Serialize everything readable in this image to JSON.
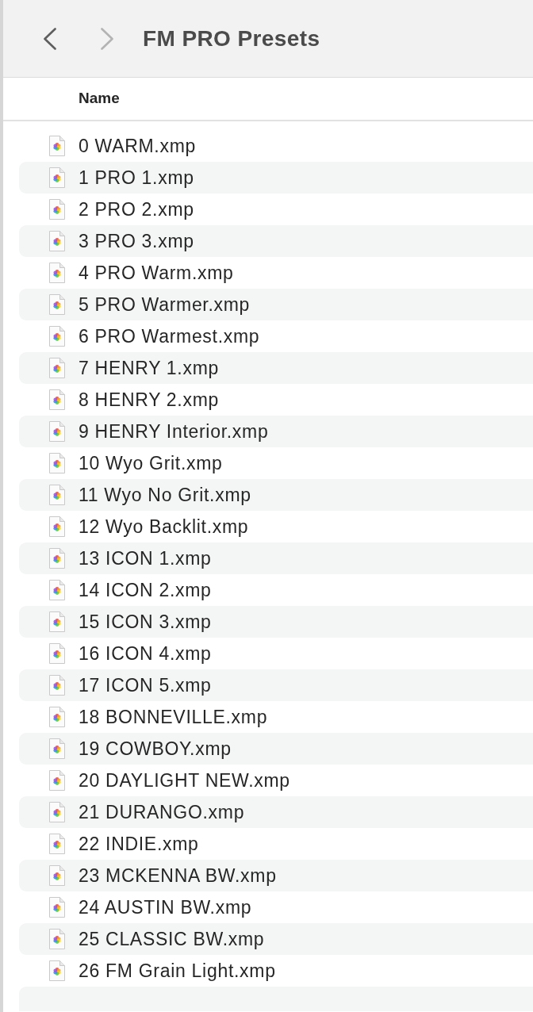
{
  "toolbar": {
    "back_button": {
      "disabled": false
    },
    "forward_button": {
      "disabled": true
    },
    "title": "FM PRO Presets"
  },
  "table": {
    "columns": [
      {
        "label": "Name"
      }
    ],
    "rows": [
      {
        "name": "0 WARM.xmp",
        "selected": false
      },
      {
        "name": "1 PRO 1.xmp",
        "selected": false
      },
      {
        "name": "2 PRO 2.xmp",
        "selected": false
      },
      {
        "name": "3 PRO 3.xmp",
        "selected": false
      },
      {
        "name": "4 PRO Warm.xmp",
        "selected": false
      },
      {
        "name": "5 PRO Warmer.xmp",
        "selected": false
      },
      {
        "name": "6 PRO Warmest.xmp",
        "selected": false
      },
      {
        "name": "7 HENRY 1.xmp",
        "selected": false
      },
      {
        "name": "8 HENRY 2.xmp",
        "selected": false
      },
      {
        "name": "9 HENRY Interior.xmp",
        "selected": false
      },
      {
        "name": "10 Wyo Grit.xmp",
        "selected": false
      },
      {
        "name": "11 Wyo No Grit.xmp",
        "selected": false
      },
      {
        "name": "12 Wyo Backlit.xmp",
        "selected": false
      },
      {
        "name": "13 ICON 1.xmp",
        "selected": false
      },
      {
        "name": "14 ICON 2.xmp",
        "selected": false
      },
      {
        "name": "15 ICON 3.xmp",
        "selected": false
      },
      {
        "name": "16 ICON 4.xmp",
        "selected": false
      },
      {
        "name": "17 ICON 5.xmp",
        "selected": false
      },
      {
        "name": "18 BONNEVILLE.xmp",
        "selected": false
      },
      {
        "name": "19 COWBOY.xmp",
        "selected": false
      },
      {
        "name": "20 DAYLIGHT NEW.xmp",
        "selected": false
      },
      {
        "name": "21 DURANGO.xmp",
        "selected": false
      },
      {
        "name": "22 INDIE.xmp",
        "selected": false
      },
      {
        "name": "23 MCKENNA BW.xmp",
        "selected": false
      },
      {
        "name": "24 AUSTIN BW.xmp",
        "selected": false
      },
      {
        "name": "25 CLASSIC BW.xmp",
        "selected": false
      },
      {
        "name": "26 FM Grain Light.xmp",
        "selected": false
      }
    ]
  }
}
